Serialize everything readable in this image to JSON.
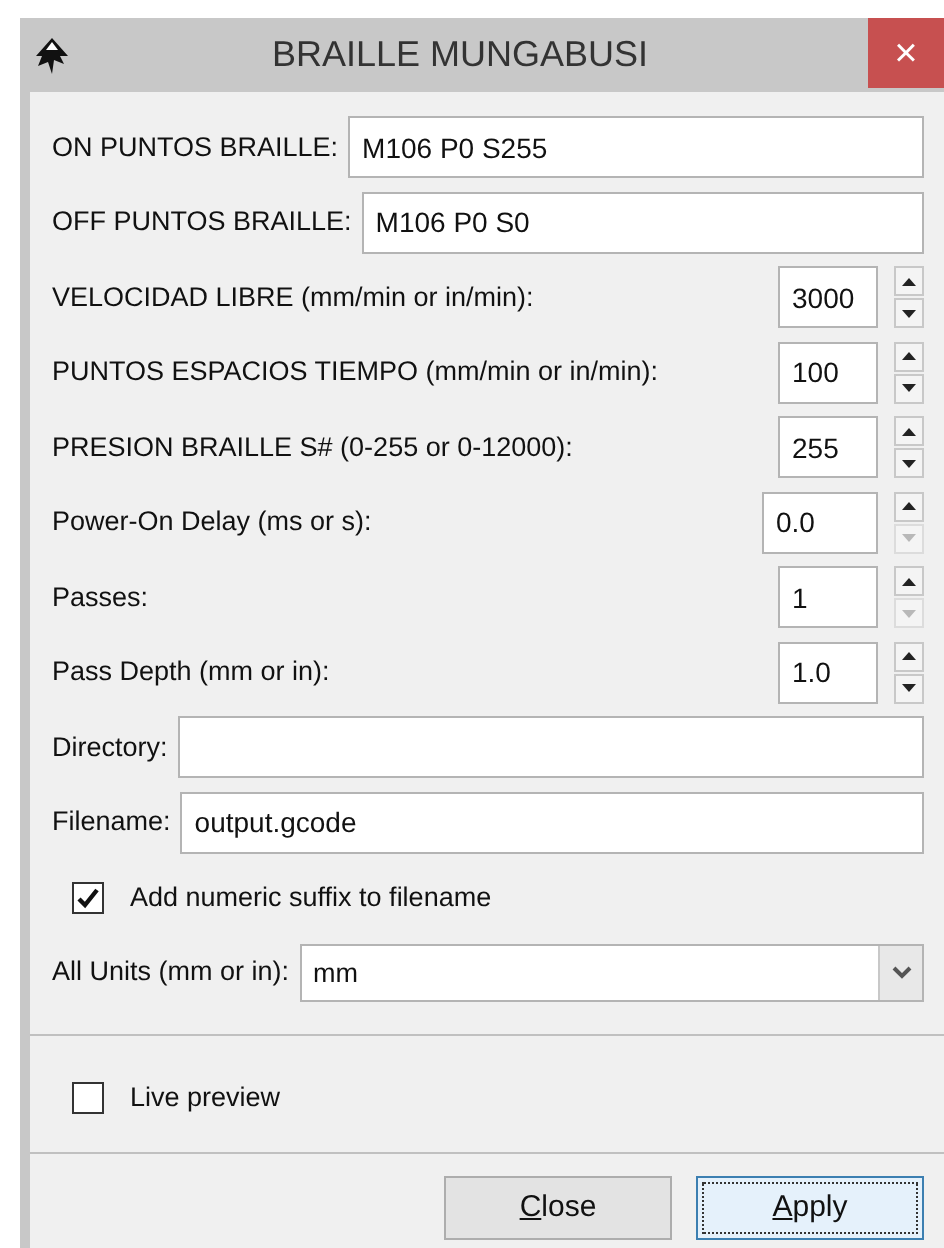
{
  "window": {
    "title": "BRAILLE MUNGABUSI",
    "close": "×"
  },
  "fields": [
    {
      "kind": "text",
      "label": "ON PUNTOS BRAILLE:",
      "value": "M106 P0 S255"
    },
    {
      "kind": "text",
      "label": "OFF PUNTOS BRAILLE:",
      "value": "M106 P0 S0"
    },
    {
      "kind": "spin",
      "label": "VELOCIDAD LIBRE (mm/min or in/min):",
      "value": "3000",
      "down_disabled": false
    },
    {
      "kind": "spin",
      "label": "PUNTOS ESPACIOS TIEMPO (mm/min or in/min):",
      "value": "100",
      "down_disabled": false
    },
    {
      "kind": "spin",
      "label": "PRESION BRAILLE S# (0-255 or 0-12000):",
      "value": "255",
      "down_disabled": false
    },
    {
      "kind": "spin",
      "label": "Power-On Delay (ms or s):",
      "value": "0.0",
      "down_disabled": true
    },
    {
      "kind": "spin",
      "label": "Passes:",
      "value": "1",
      "down_disabled": true
    },
    {
      "kind": "spin",
      "label": "Pass Depth (mm or in):",
      "value": "1.0",
      "down_disabled": false
    },
    {
      "kind": "text",
      "label": "Directory:"
    },
    {
      "kind": "text",
      "label": "Filename:",
      "value": "output.gcode"
    },
    {
      "kind": "checkbox",
      "label": "Add numeric suffix to filename",
      "checked": true
    },
    {
      "kind": "select",
      "label": "All Units (mm or in):",
      "value": "mm"
    }
  ],
  "live_preview": {
    "label": "Live preview",
    "checked": false
  },
  "buttons": [
    {
      "label": "Close",
      "underline_first": true,
      "focused": false
    },
    {
      "label": "Apply",
      "underline_first": true,
      "focused": true
    }
  ]
}
